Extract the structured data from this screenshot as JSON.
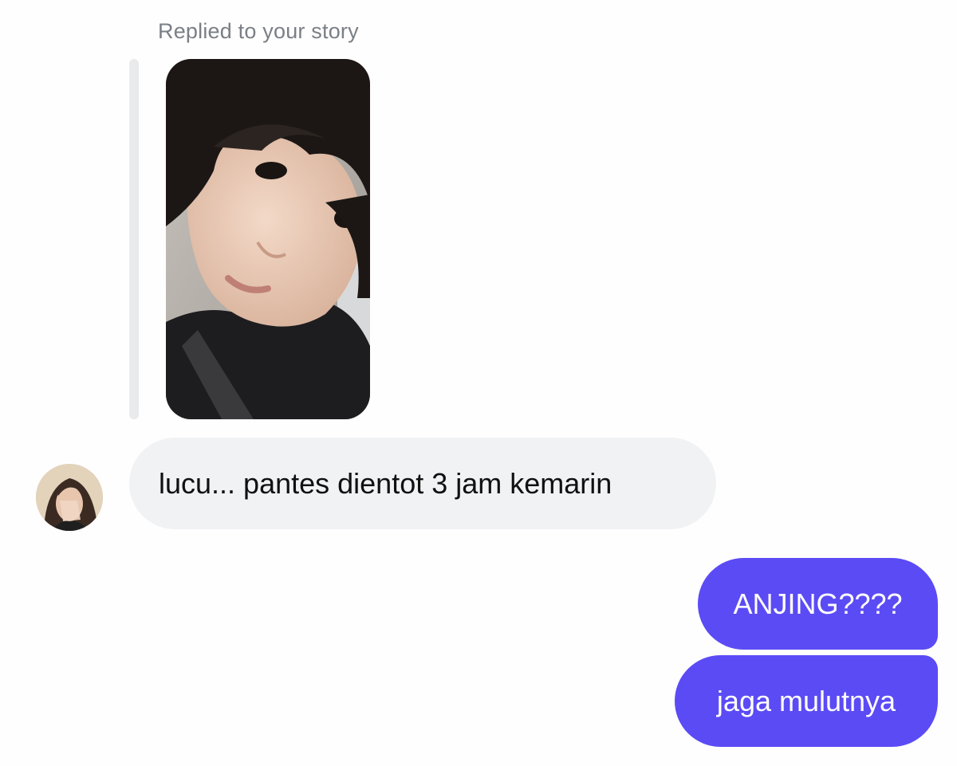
{
  "conversation": {
    "story_reply_label": "Replied to your story",
    "messages": [
      {
        "sender": "other",
        "text": "lucu... pantes dientot 3 jam kemarin"
      },
      {
        "sender": "me",
        "text": "ANJING????"
      },
      {
        "sender": "me",
        "text": "jaga mulutnya"
      }
    ]
  },
  "colors": {
    "sent_bubble": "#5b4bf5",
    "received_bubble": "#f1f2f4",
    "label_gray": "#7a7f86"
  },
  "icons": {
    "story": "story-thumbnail-photo",
    "avatar": "user-avatar-photo"
  }
}
